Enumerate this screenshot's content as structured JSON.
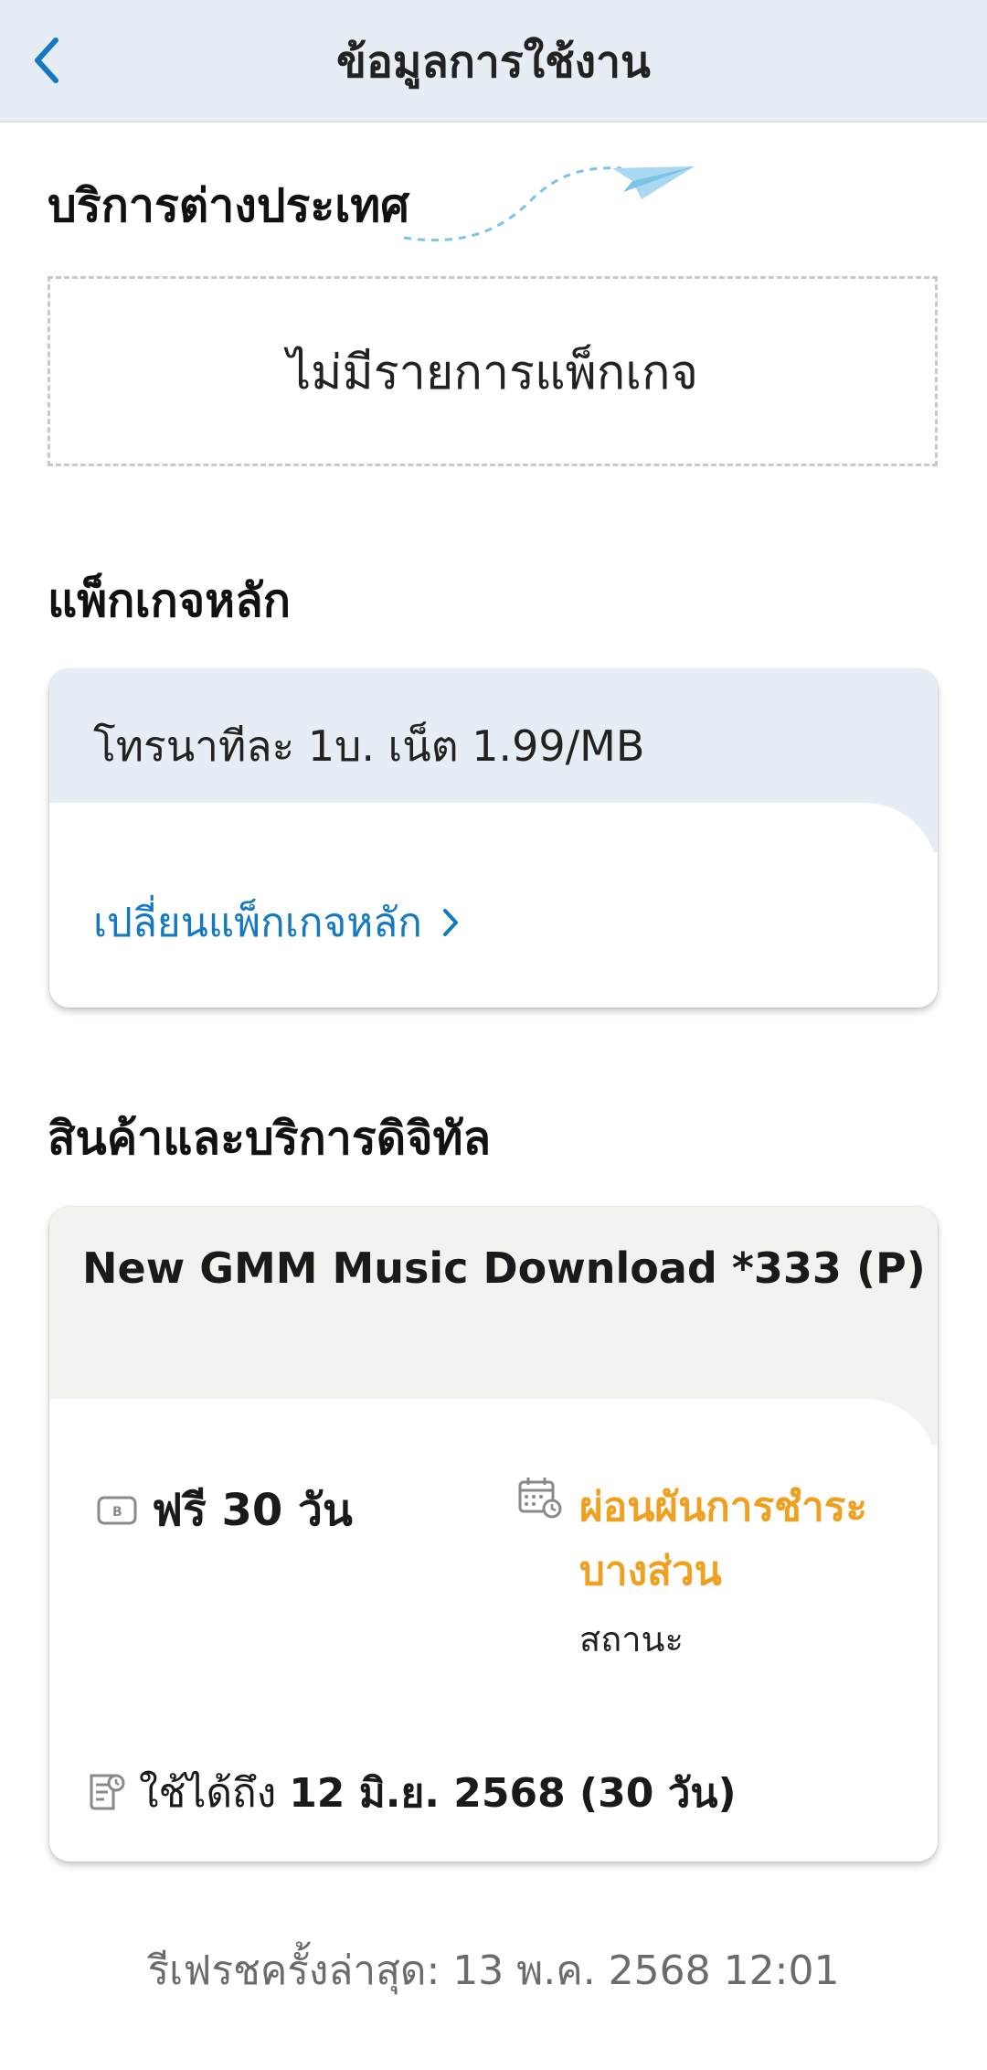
{
  "header": {
    "title": "ข้อมูลการใช้งาน",
    "back_icon": "chevron-left-icon"
  },
  "overseas": {
    "title": "บริการต่างประเทศ",
    "empty_text": "ไม่มีรายการแพ็กเกจ",
    "decoration_icon": "paper-plane-icon"
  },
  "main_package": {
    "title": "แพ็กเกจหลัก",
    "plan_name": "โทรนาทีละ 1บ. เน็ต 1.99/MB",
    "change_link": "เปลี่ยนแพ็กเกจหลัก"
  },
  "digital": {
    "title": "สินค้าและบริการดิจิทัล",
    "product_name": "New GMM Music Download *333 (P)",
    "price": "ฟรี 30 วัน",
    "status_value": "ผ่อนผันการชำระบางส่วน",
    "status_label": "สถานะ",
    "valid_prefix": "ใช้ได้ถึง",
    "valid_date": "12 มิ.ย. 2568 (30 วัน)"
  },
  "footer": {
    "refresh_text": "รีเฟรชครั้งล่าสุด: 13 พ.ค. 2568 12:01"
  },
  "colors": {
    "header_bg": "#e6edf4",
    "link": "#1479c2",
    "status_warning": "#f0a020"
  }
}
